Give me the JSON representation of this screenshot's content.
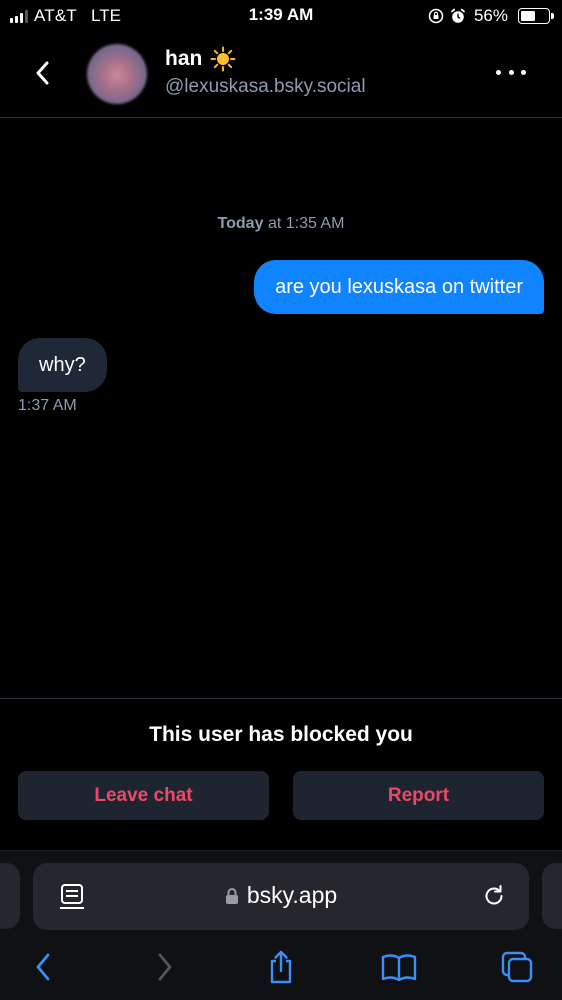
{
  "status_bar": {
    "carrier": "AT&T",
    "network": "LTE",
    "time": "1:39 AM",
    "battery_percent": "56%",
    "battery_level": 0.56,
    "icons": [
      "signal-icon",
      "orientation-lock-icon",
      "alarm-icon",
      "battery-icon"
    ]
  },
  "header": {
    "back_icon": "chevron-left-icon",
    "name": "han",
    "name_emoji": "☀️",
    "handle": "@lexuskasa.bsky.social",
    "more_icon": "more-horizontal-icon"
  },
  "conversation": {
    "day_label": "Today",
    "day_time": "at 1:35 AM",
    "messages": [
      {
        "direction": "outgoing",
        "text": "are you lexuskasa on twitter"
      },
      {
        "direction": "incoming",
        "text": "why?",
        "time": "1:37 AM"
      }
    ]
  },
  "blocked": {
    "message": "This user has blocked you",
    "leave_label": "Leave chat",
    "report_label": "Report"
  },
  "safari": {
    "url": "bsky.app",
    "icons": [
      "reader-icon",
      "lock-icon",
      "reload-icon",
      "back-icon",
      "forward-icon",
      "share-icon",
      "bookmarks-icon",
      "tabs-icon"
    ]
  },
  "colors": {
    "accent_blue": "#1083fe",
    "incoming_bubble": "#1e2836",
    "danger_red": "#ec4868",
    "muted_text": "#8e9bb0",
    "ios_blue": "#3e8ef7"
  }
}
